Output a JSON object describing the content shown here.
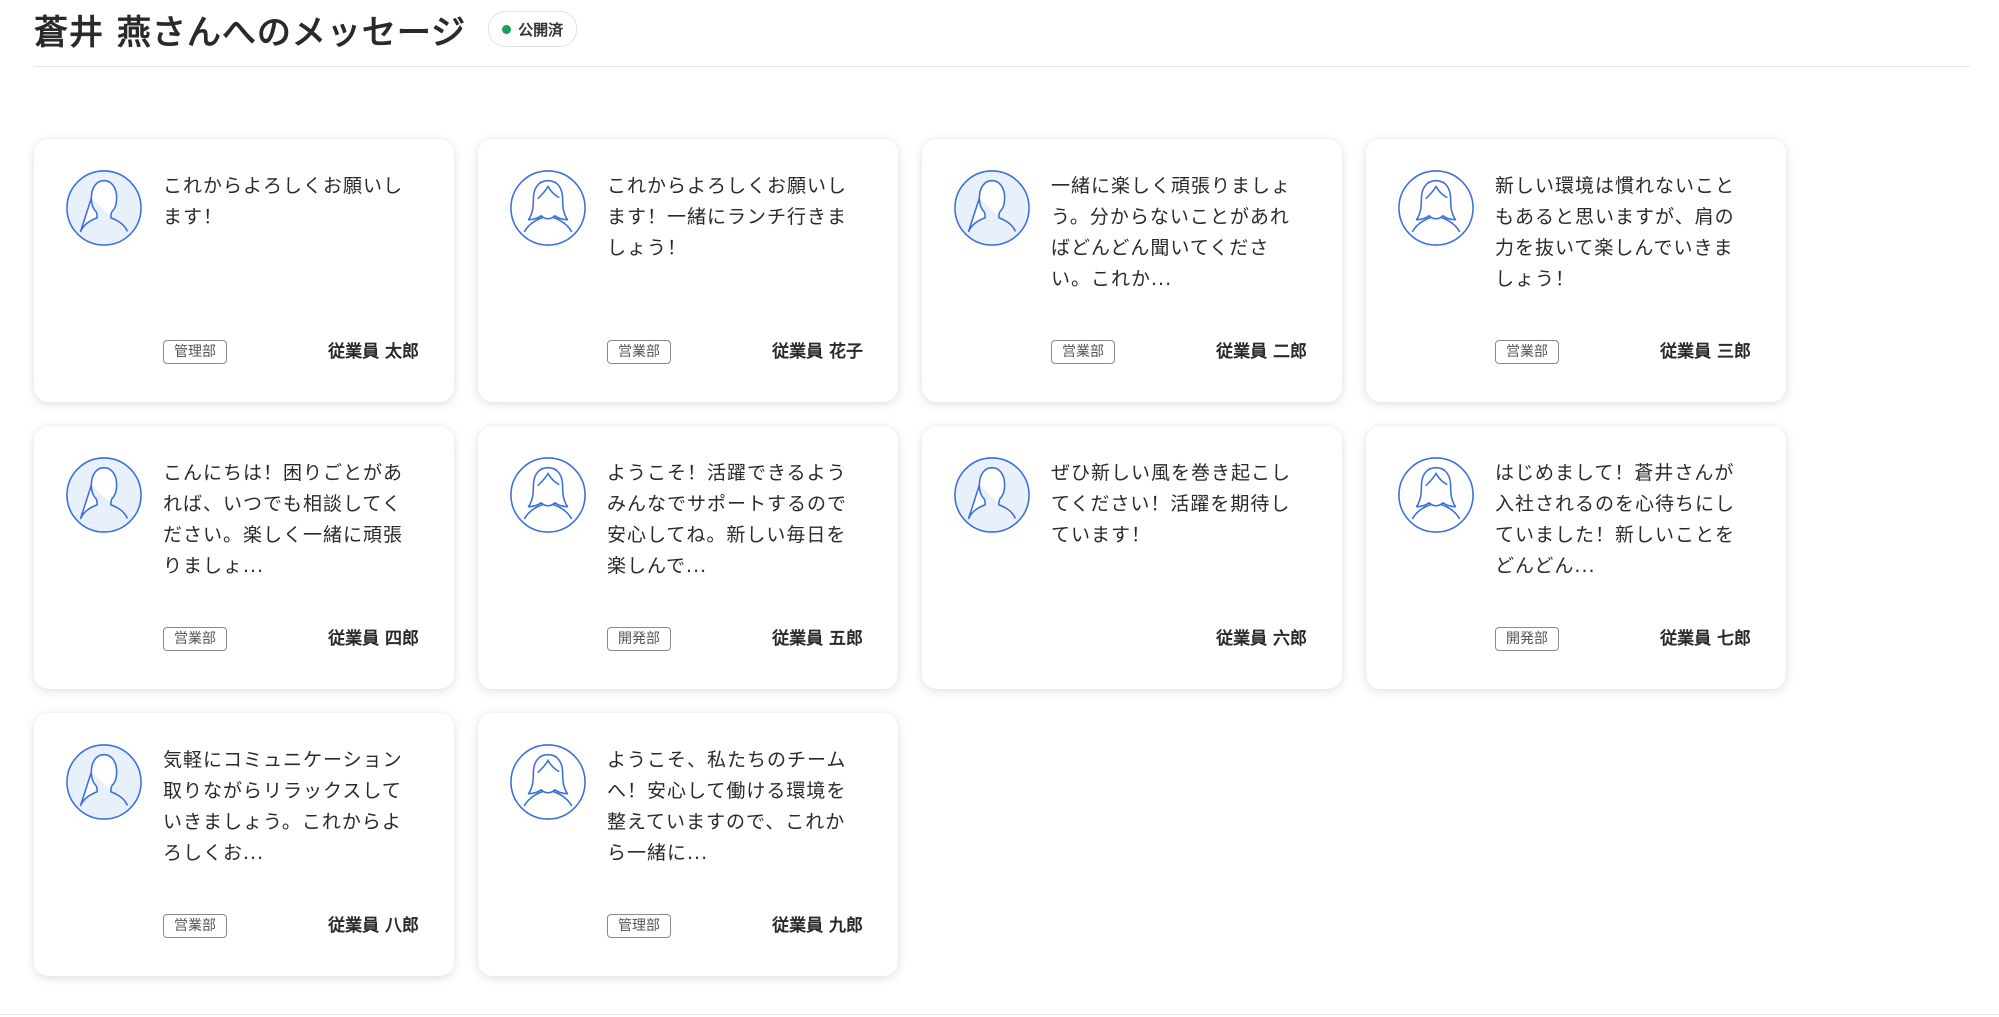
{
  "header": {
    "title": "蒼井 燕さんへのメッセージ",
    "status": "公開済",
    "status_color": "#1e9e5a"
  },
  "cards": [
    {
      "avatar": "male",
      "message": "これからよろしくお願いします！",
      "department": "管理部",
      "sender": "従業員 太郎"
    },
    {
      "avatar": "female",
      "message": "これからよろしくお願いします！一緒にランチ行きましょう！",
      "department": "営業部",
      "sender": "従業員 花子"
    },
    {
      "avatar": "male",
      "message": "一緒に楽しく頑張りましょう。分からないことがあればどんどん聞いてください。これか...",
      "department": "営業部",
      "sender": "従業員 二郎"
    },
    {
      "avatar": "female",
      "message": "新しい環境は慣れないこともあると思いますが、肩の力を抜いて楽しんでいきましょう！",
      "department": "営業部",
      "sender": "従業員 三郎"
    },
    {
      "avatar": "male",
      "message": "こんにちは！困りごとがあれば、いつでも相談してください。楽しく一緒に頑張りましょ...",
      "department": "営業部",
      "sender": "従業員 四郎"
    },
    {
      "avatar": "female",
      "message": "ようこそ！活躍できるようみんなでサポートするので安心してね。新しい毎日を楽しんで...",
      "department": "開発部",
      "sender": "従業員 五郎"
    },
    {
      "avatar": "male",
      "message": "ぜひ新しい風を巻き起こしてください！活躍を期待しています！",
      "department": "",
      "sender": "従業員 六郎"
    },
    {
      "avatar": "female",
      "message": "はじめまして！蒼井さんが入社されるのを心待ちにしていました！新しいことをどんどん...",
      "department": "開発部",
      "sender": "従業員 七郎"
    },
    {
      "avatar": "male",
      "message": "気軽にコミュニケーション取りながらリラックスしていきましょう。これからよろしくお...",
      "department": "営業部",
      "sender": "従業員 八郎"
    },
    {
      "avatar": "female",
      "message": "ようこそ、私たちのチームへ！安心して働ける環境を整えていますので、これから一緒に...",
      "department": "管理部",
      "sender": "従業員 九郎"
    }
  ],
  "colors": {
    "avatar_stroke": "#3a6fdc",
    "avatar_fill": "#e8f0fc"
  }
}
